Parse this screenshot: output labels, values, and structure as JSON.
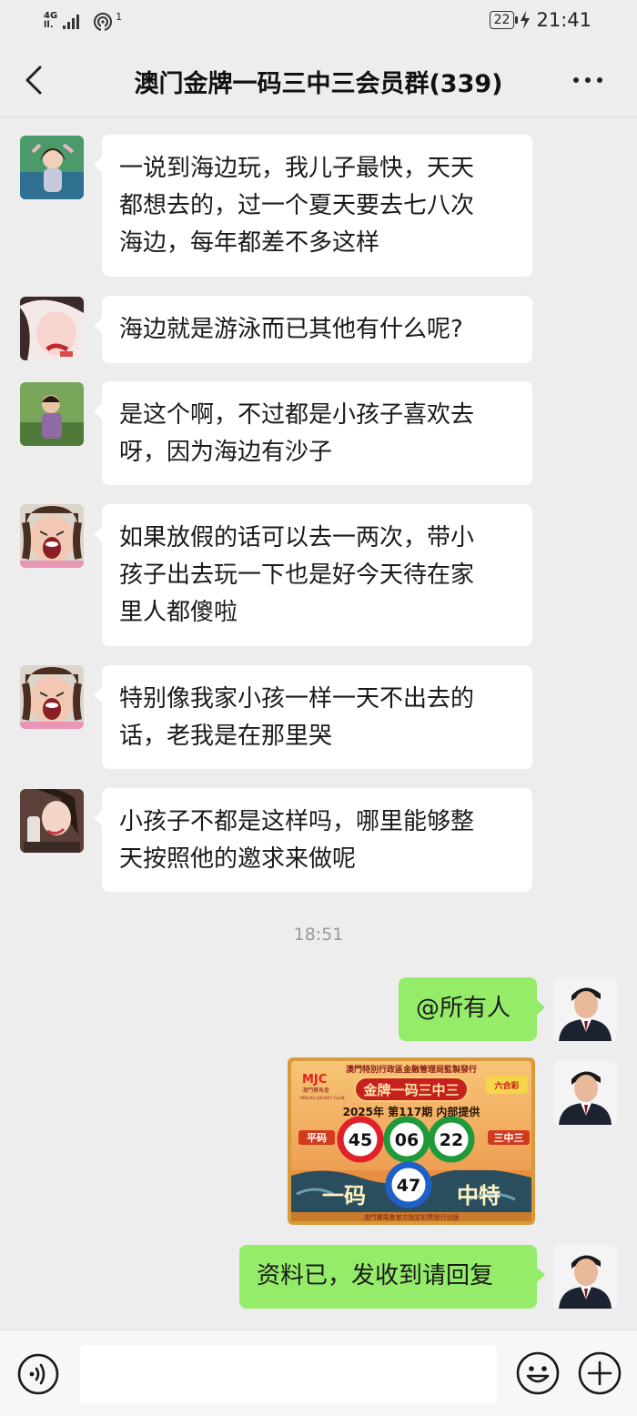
{
  "status_bar": {
    "network_top": "4G",
    "network_bottom": "ll.",
    "hotspot_sup": "1",
    "battery": "22",
    "time": "21:41"
  },
  "header": {
    "title": "澳门金牌一码三中三会员群(339)"
  },
  "messages": [
    {
      "text": "一说到海边玩，我儿子最快，天天\n都想去的，过一个夏天要去七八次\n海边，每年都差不多这样"
    },
    {
      "text": "海边就是游泳而已其他有什么呢?"
    },
    {
      "text": "是这个啊，不过都是小孩子喜欢去\n呀，因为海边有沙子"
    },
    {
      "text": "如果放假的话可以去一两次，带小\n孩子出去玩一下也是好今天待在家\n里人都傻啦"
    },
    {
      "text": "特别像我家小孩一样一天不出去的\n话，老我是在那里哭"
    },
    {
      "text": "小孩子不都是这样吗，哪里能够整\n天按照他的邀求来做呢"
    }
  ],
  "timestamp": "18:51",
  "my_messages": [
    {
      "text": "@所有人"
    },
    {
      "text": "资料已，发收到请回复"
    }
  ],
  "promo_image": {
    "top_banner": "澳門特別行政區金融管理局監製發行",
    "brand": "MJC",
    "brand_cn": "澳門賽馬會",
    "brand_en": "MACAU JOCKEY CLUB",
    "title": "金牌一码三中三",
    "issue": "2025年 第117期 内部提供",
    "left_label": "平码",
    "right_label": "三中三",
    "balls": [
      "45",
      "06",
      "22"
    ],
    "special_ball": "47",
    "bottom_left": "一码",
    "bottom_right": "中特",
    "footer": "澳門賽馬會官方指定彩票發行出版",
    "badge": "六合彩"
  },
  "colors": {
    "background": "#ededed",
    "bubble_mine": "#95ec69",
    "bubble_other": "#ffffff",
    "ball_red": "#e0202a",
    "ball_green": "#1f9a3a",
    "ball_blue": "#1f5fc8"
  },
  "icons": [
    "back-arrow-icon",
    "more-dots-icon",
    "voice-icon",
    "emoji-icon",
    "plus-icon"
  ]
}
